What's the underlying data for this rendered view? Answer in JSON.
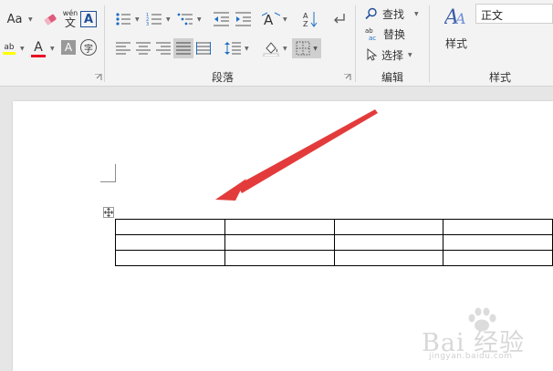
{
  "ribbon": {
    "font_group": {
      "change_case_label": "Aa",
      "phonetic_top": "wén",
      "phonetic_bottom": "文",
      "highlight_label": "ab",
      "font_color_label": "A",
      "char_shading_label": "A",
      "enclose_char_label": "字"
    },
    "paragraph_group": {
      "label": "段落"
    },
    "editing_group": {
      "label": "编辑",
      "find_label": "查找",
      "replace_label": "替换",
      "select_label": "选择"
    },
    "styles_group": {
      "label": "样式",
      "styles_button_label": "样式",
      "current_style": "正文"
    },
    "colors": {
      "accent_red": "#e02020",
      "highlight_yellow": "#ffff00",
      "font_red": "#e81123"
    }
  },
  "document": {
    "table": {
      "rows": 3,
      "cols": 4
    },
    "annotation_color": "#e03a3a"
  },
  "watermark": {
    "brand": "Bai 经验",
    "url": "jingyan.baidu.com"
  }
}
